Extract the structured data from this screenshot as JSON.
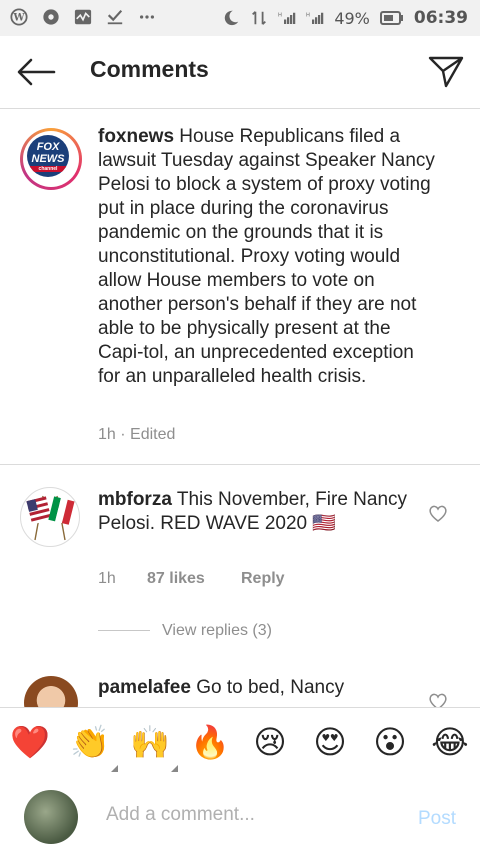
{
  "status_bar": {
    "battery": "49%",
    "time": "06:39",
    "icons": [
      "wordpress-icon",
      "aperture-icon",
      "activity-icon",
      "download-check-icon",
      "more-dots-icon",
      "moon-icon",
      "data-transfer-icon",
      "signal-h-icon",
      "signal-h-icon",
      "battery-icon"
    ]
  },
  "header": {
    "title": "Comments"
  },
  "caption": {
    "username": "foxnews",
    "text": " House Republicans filed a lawsuit Tuesday against Speaker Nancy Pelosi to block a system of proxy voting put in place during the coronavirus pandemic on the grounds that it is unconstitutional. Proxy voting would allow House members to vote on another person's behalf if they are not able to be physically present at the Capi-tol, an unprecedented exception for an unparalleled health crisis.",
    "time": "1h",
    "edited": "Edited",
    "separator": " · ",
    "avatar_logo": [
      "FOX",
      "NEWS",
      "channel"
    ]
  },
  "comments": [
    {
      "username": "mbforza",
      "text": " This November, Fire Nancy Pelosi. RED WAVE 2020 🇺🇸",
      "time": "1h",
      "likes": "87 likes",
      "reply": "Reply",
      "view_replies": "View replies (3)"
    },
    {
      "username": "pamelafee",
      "text": " Go to bed, Nancy"
    }
  ],
  "emoji_bar": [
    "❤️",
    "👏",
    "🙌",
    "🔥",
    "😢",
    "😍",
    "😮",
    "😂"
  ],
  "compose": {
    "placeholder": "Add a comment...",
    "post_label": "Post"
  },
  "colors": {
    "post_inactive": "#b3dbff",
    "meta_gray": "#8e8e8e",
    "heart_red": "#ed4956"
  }
}
